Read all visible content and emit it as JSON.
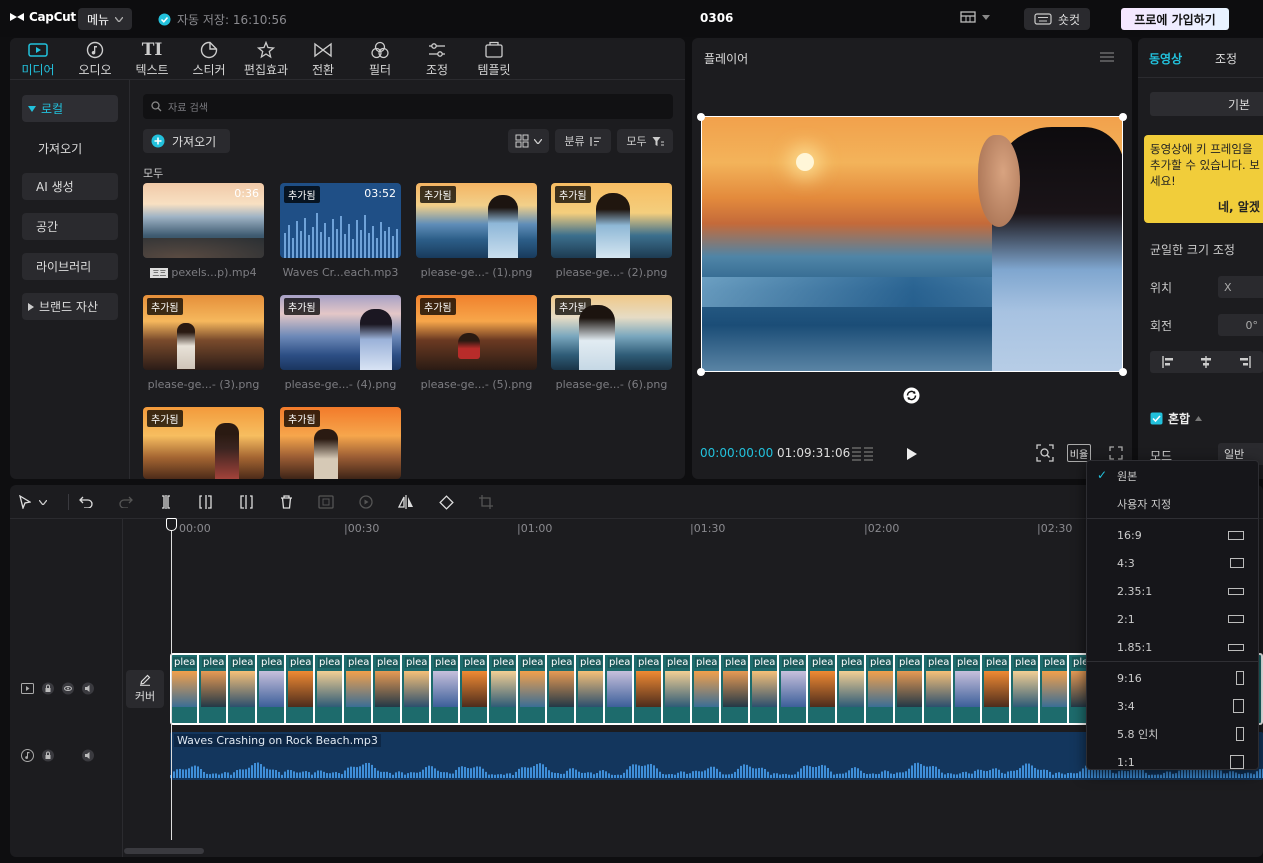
{
  "app": {
    "logo": "CapCut",
    "menu_label": "메뉴",
    "save_status": "자동 저장: 16:10:56",
    "project_title": "0306",
    "shortcut_label": "숏컷",
    "pro_label": "프로에 가입하기"
  },
  "media_tabs": [
    {
      "label": "미디어",
      "icon": "media-icon"
    },
    {
      "label": "오디오",
      "icon": "audio-icon"
    },
    {
      "label": "텍스트",
      "icon": "text-icon"
    },
    {
      "label": "스티커",
      "icon": "sticker-icon"
    },
    {
      "label": "편집효과",
      "icon": "effects-icon"
    },
    {
      "label": "전환",
      "icon": "transition-icon"
    },
    {
      "label": "필터",
      "icon": "filter-icon"
    },
    {
      "label": "조정",
      "icon": "adjust-icon"
    },
    {
      "label": "템플릿",
      "icon": "template-icon"
    }
  ],
  "left_nav": [
    {
      "label": "로컬"
    },
    {
      "label": "가져오기"
    },
    {
      "label": "AI 생성"
    },
    {
      "label": "공간"
    },
    {
      "label": "라이브러리"
    },
    {
      "label": "브랜드 자산"
    }
  ],
  "search": {
    "placeholder": "자료 검색"
  },
  "import_label": "가져오기",
  "sort_label": "분류",
  "filter_label": "모두",
  "section_label": "모두",
  "media_items": [
    {
      "name": "pexels...p).mp4",
      "badge": "",
      "duration": "0:36",
      "kind": "video"
    },
    {
      "name": "Waves Cr...each.mp3",
      "badge": "추가됨",
      "duration": "03:52",
      "kind": "audio"
    },
    {
      "name": "please-ge...- (1).png",
      "badge": "추가됨",
      "duration": "",
      "kind": "image"
    },
    {
      "name": "please-ge...- (2).png",
      "badge": "추가됨",
      "duration": "",
      "kind": "image"
    },
    {
      "name": "please-ge...- (3).png",
      "badge": "추가됨",
      "duration": "",
      "kind": "image"
    },
    {
      "name": "please-ge...- (4).png",
      "badge": "추가됨",
      "duration": "",
      "kind": "image"
    },
    {
      "name": "please-ge...- (5).png",
      "badge": "추가됨",
      "duration": "",
      "kind": "image"
    },
    {
      "name": "please-ge...- (6).png",
      "badge": "추가됨",
      "duration": "",
      "kind": "image"
    },
    {
      "name": "",
      "badge": "추가됨",
      "duration": "",
      "kind": "image"
    },
    {
      "name": "",
      "badge": "추가됨",
      "duration": "",
      "kind": "image"
    }
  ],
  "player": {
    "title": "플레이어",
    "current_time": "00:00:00:00",
    "total_time": "01:09:31:06",
    "ratio_label": "비율"
  },
  "props": {
    "tab_video": "동영상",
    "tab_adjust": "조정",
    "basic_label": "기본",
    "tip_text": "동영상에 키 프레임을 추가할 수 있습니다. 보세요!",
    "tip_button": "네, 알겠",
    "uniform_scale": "균일한 크기 조정",
    "position_label": "위치",
    "position_x": "X",
    "rotation_label": "회전",
    "rotation_value": "0°",
    "blend_label": "혼합",
    "mode_label": "모드",
    "mode_value": "일반"
  },
  "timeline": {
    "ticks": [
      "00:00",
      "00:30",
      "01:00",
      "01:30",
      "02:00",
      "02:30"
    ],
    "cover_label": "커버",
    "clip_label": "plea",
    "audio_label": "Waves Crashing on Rock Beach.mp3"
  },
  "ratio_menu": {
    "items": [
      {
        "label": "원본",
        "checked": true,
        "shape": "none"
      },
      {
        "label": "사용자 지정",
        "checked": false,
        "shape": "none"
      },
      {
        "label": "16:9",
        "checked": false,
        "shape": "wide"
      },
      {
        "label": "4:3",
        "checked": false,
        "shape": "std"
      },
      {
        "label": "2.35:1",
        "checked": false,
        "shape": "ultra"
      },
      {
        "label": "2:1",
        "checked": false,
        "shape": "twoone"
      },
      {
        "label": "1.85:1",
        "checked": false,
        "shape": "ultra"
      },
      {
        "label": "9:16",
        "checked": false,
        "shape": "tall"
      },
      {
        "label": "3:4",
        "checked": false,
        "shape": "portrait"
      },
      {
        "label": "5.8 인치",
        "checked": false,
        "shape": "tall"
      },
      {
        "label": "1:1",
        "checked": false,
        "shape": "square"
      }
    ]
  },
  "colors": {
    "accent": "#22c1dc",
    "panel": "#1c1c1f",
    "background": "#0e0e10",
    "tip": "#f1cd3a"
  }
}
